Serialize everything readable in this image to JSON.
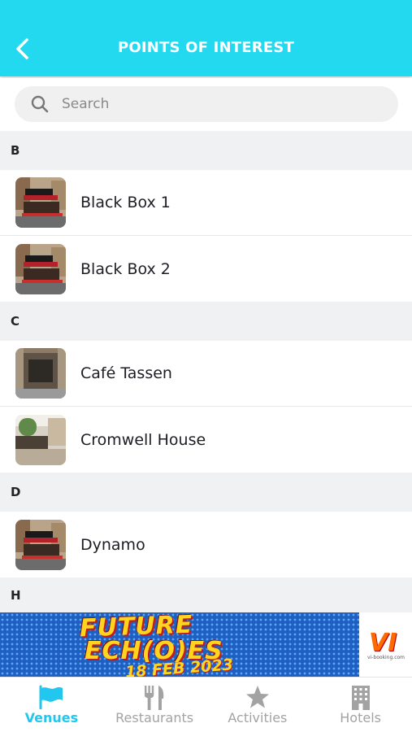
{
  "header": {
    "title": "POINTS OF INTEREST"
  },
  "search": {
    "placeholder": "Search"
  },
  "sections": [
    {
      "letter": "B",
      "items": [
        "Black Box 1",
        "Black Box 2"
      ]
    },
    {
      "letter": "C",
      "items": [
        "Café Tassen",
        "Cromwell House"
      ]
    },
    {
      "letter": "D",
      "items": [
        "Dynamo"
      ]
    },
    {
      "letter": "H",
      "items": []
    }
  ],
  "banner": {
    "line1": "FUTURE",
    "line2": "ECH(O)ES",
    "line3": "18 FEB 2023",
    "right_text": "VI",
    "right_sub": "vi-booking.com"
  },
  "tabs": [
    {
      "label": "Venues",
      "icon": "flag-icon",
      "active": true
    },
    {
      "label": "Restaurants",
      "icon": "fork-knife-icon",
      "active": false
    },
    {
      "label": "Activities",
      "icon": "star-icon",
      "active": false
    },
    {
      "label": "Hotels",
      "icon": "building-icon",
      "active": false
    }
  ],
  "colors": {
    "accent": "#22d9f0",
    "active_tab": "#22c7ef",
    "inactive_tab": "#a3a3a3"
  }
}
